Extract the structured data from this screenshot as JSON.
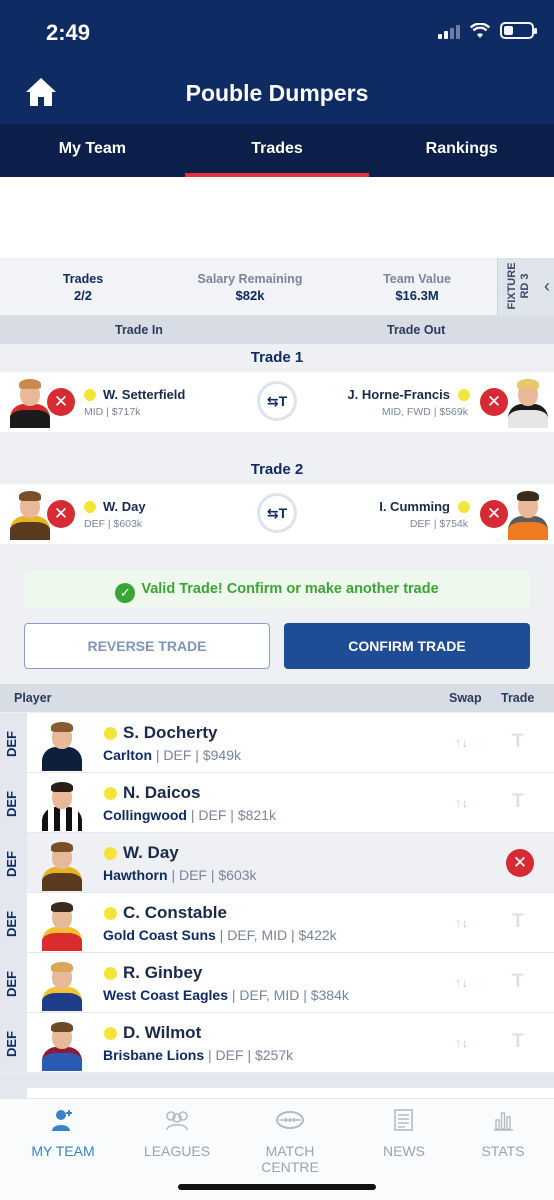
{
  "status": {
    "time": "2:49"
  },
  "header": {
    "title": "Pouble Dumpers"
  },
  "tabs": [
    {
      "label": "My Team"
    },
    {
      "label": "Trades"
    },
    {
      "label": "Rankings"
    }
  ],
  "summary": {
    "trades_label": "Trades",
    "trades_value": "2/2",
    "salary_label": "Salary Remaining",
    "salary_value": "$82k",
    "value_label": "Team Value",
    "value_value": "$16.3M",
    "fixture_line1": "FIXTURE",
    "fixture_line2": "RD 3"
  },
  "trade_head": {
    "in": "Trade In",
    "out": "Trade Out"
  },
  "trades": [
    {
      "title": "Trade 1",
      "in": {
        "name": "W. Setterfield",
        "meta": "MID | $717k"
      },
      "out": {
        "name": "J. Horne-Francis",
        "meta": "MID, FWD | $569k"
      }
    },
    {
      "title": "Trade 2",
      "in": {
        "name": "W. Day",
        "meta": "DEF | $603k"
      },
      "out": {
        "name": "I. Cumming",
        "meta": "DEF | $754k"
      }
    }
  ],
  "swap_symbol": "⇆T",
  "valid_msg": "Valid Trade! Confirm or make another trade",
  "buttons": {
    "reverse": "REVERSE TRADE",
    "confirm": "CONFIRM TRADE"
  },
  "list_head": {
    "player": "Player",
    "swap": "Swap",
    "trade": "Trade"
  },
  "players": [
    {
      "pos": "DEF",
      "name": "S. Docherty",
      "club": "Carlton",
      "meta": " | DEF | $949k"
    },
    {
      "pos": "DEF",
      "name": "N. Daicos",
      "club": "Collingwood",
      "meta": " | DEF | $821k"
    },
    {
      "pos": "DEF",
      "name": "W. Day",
      "club": "Hawthorn",
      "meta": " | DEF | $603k"
    },
    {
      "pos": "DEF",
      "name": "C. Constable",
      "club": "Gold Coast Suns",
      "meta": " | DEF, MID | $422k"
    },
    {
      "pos": "DEF",
      "name": "R. Ginbey",
      "club": "West Coast Eagles",
      "meta": " | DEF, MID | $384k"
    },
    {
      "pos": "DEF",
      "name": "D. Wilmot",
      "club": "Brisbane Lions",
      "meta": " | DEF | $257k"
    }
  ],
  "trade_t": "T",
  "remove_x": "✕",
  "nav": [
    {
      "label": "MY TEAM",
      "icon": "my-team-icon"
    },
    {
      "label": "LEAGUES",
      "icon": "leagues-icon"
    },
    {
      "label": "MATCH CENTRE",
      "icon": "match-centre-icon"
    },
    {
      "label": "NEWS",
      "icon": "news-icon"
    },
    {
      "label": "STATS",
      "icon": "stats-icon"
    }
  ],
  "colors": {
    "navy": "#0f2b63",
    "accent_red": "#e2323a",
    "remove_red": "#d62b34",
    "valid_green": "#3aa537",
    "confirm_blue": "#1e4c95",
    "nav_active": "#3a82c8"
  }
}
